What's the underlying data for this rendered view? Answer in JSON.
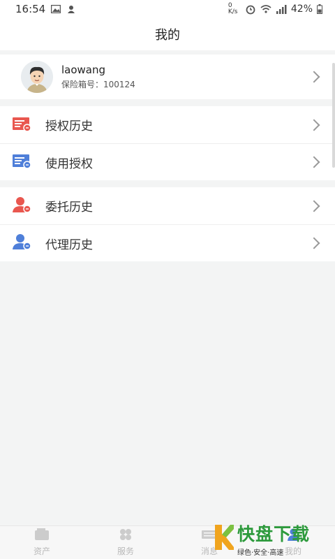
{
  "status_bar": {
    "time": "16:54",
    "speed": "0 K/s",
    "battery": "42%"
  },
  "page": {
    "title": "我的"
  },
  "profile": {
    "username": "laowang",
    "box_label": "保险箱号：100124"
  },
  "group1": [
    {
      "label": "授权历史",
      "icon": "document-red-icon",
      "color": "#e9574f"
    },
    {
      "label": "使用授权",
      "icon": "document-blue-icon",
      "color": "#4f7fd9"
    }
  ],
  "group2": [
    {
      "label": "委托历史",
      "icon": "user-red-icon",
      "color": "#e9574f"
    },
    {
      "label": "代理历史",
      "icon": "user-blue-icon",
      "color": "#4f7fd9"
    }
  ],
  "tabs": [
    {
      "label": "资产",
      "icon": "wallet-icon"
    },
    {
      "label": "服务",
      "icon": "grid-icon"
    },
    {
      "label": "消息",
      "icon": "keyboard-icon"
    },
    {
      "label": "我的",
      "icon": "user-icon"
    }
  ],
  "watermark": {
    "brand": "快盘下载",
    "slogan": "绿色·安全·高速"
  }
}
